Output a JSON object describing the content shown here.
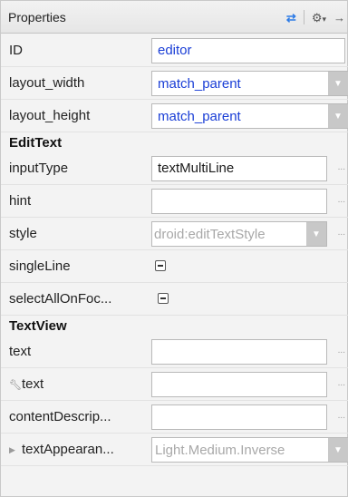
{
  "panel": {
    "title": "Properties",
    "tools": {
      "swap_icon": "⇄",
      "gear_icon": "⚙",
      "dropdown_caret": "▾",
      "pin_icon": "→"
    }
  },
  "rows": {
    "id": {
      "label": "ID",
      "value": "editor"
    },
    "layout_width": {
      "label": "layout_width",
      "value": "match_parent"
    },
    "layout_height": {
      "label": "layout_height",
      "value": "match_parent"
    },
    "section_edittext": {
      "label": "EditText"
    },
    "inputType": {
      "label": "inputType",
      "value": "textMultiLine"
    },
    "hint": {
      "label": "hint",
      "value": ""
    },
    "style": {
      "label": "style",
      "value": "droid:editTextStyle"
    },
    "singleLine": {
      "label": "singleLine"
    },
    "selectAllOnFocus": {
      "label": "selectAllOnFoc..."
    },
    "section_textview": {
      "label": "TextView"
    },
    "text": {
      "label": "text",
      "value": ""
    },
    "tools_text": {
      "label": "text",
      "value": ""
    },
    "contentDescription": {
      "label": "contentDescrip...",
      "value": ""
    },
    "textAppearance": {
      "label": "textAppearan...",
      "value": "Light.Medium.Inverse"
    }
  },
  "ellipsis": "...",
  "arrow": "▼"
}
